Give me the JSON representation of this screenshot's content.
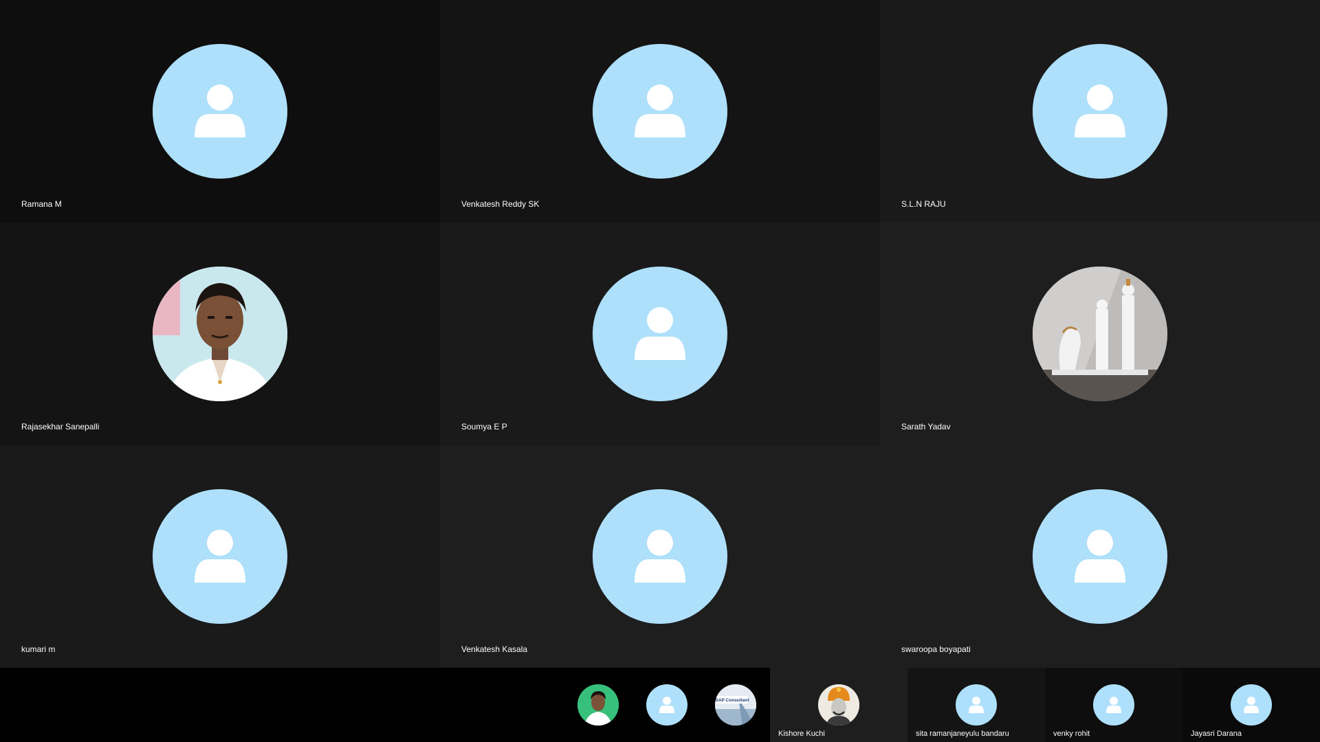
{
  "grid": {
    "tiles": [
      {
        "name": "Ramana M",
        "bg": "#0e0e0e",
        "avatar": "default"
      },
      {
        "name": "Venkatesh Reddy SK",
        "bg": "#141414",
        "avatar": "default"
      },
      {
        "name": "S.L.N RAJU",
        "bg": "#1a1a1a",
        "avatar": "default"
      },
      {
        "name": "Rajasekhar Sanepalli",
        "bg": "#141414",
        "avatar": "photo-person"
      },
      {
        "name": "Soumya E P",
        "bg": "#1a1a1a",
        "avatar": "default"
      },
      {
        "name": "Sarath Yadav",
        "bg": "#1e1e1e",
        "avatar": "photo-chess"
      },
      {
        "name": "kumari m",
        "bg": "#1a1a1a",
        "avatar": "default"
      },
      {
        "name": "Venkatesh Kasala",
        "bg": "#1e1e1e",
        "avatar": "default"
      },
      {
        "name": "swaroopa boyapati",
        "bg": "#1e1e1e",
        "avatar": "default"
      }
    ]
  },
  "strip": {
    "unnamed": [
      {
        "avatar": "photo-person-green"
      },
      {
        "avatar": "default"
      },
      {
        "avatar": "photo-sap",
        "badge_text": "SAP Consultant"
      }
    ],
    "named": [
      {
        "name": "Kishore Kuchi",
        "bg": "#1e1e1e",
        "avatar": "photo-statue"
      },
      {
        "name": "sita ramanjaneyulu bandaru",
        "bg": "#141414",
        "avatar": "default"
      },
      {
        "name": "venky rohit",
        "bg": "#0e0e0e",
        "avatar": "default"
      },
      {
        "name": "Jayasri Darana",
        "bg": "#0a0a0a",
        "avatar": "default"
      }
    ]
  },
  "colors": {
    "avatar_bg": "#aee0fb",
    "avatar_glyph": "#ffffff",
    "name_text": "#ffffff",
    "strip_bg": "#000000"
  }
}
